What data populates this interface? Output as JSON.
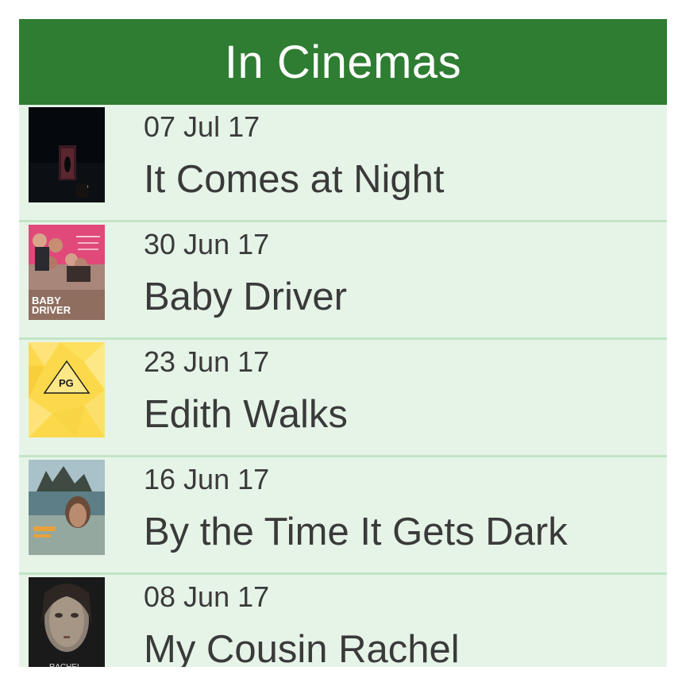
{
  "header": {
    "title": "In Cinemas"
  },
  "colors": {
    "header_bg": "#2e7d32",
    "list_bg": "#e6f4e8",
    "divider": "#c3e4c6",
    "text": "#3a3a3a"
  },
  "movies": [
    {
      "date": "07 Jul 17",
      "title": "It Comes at Night",
      "poster": "dark-door-poster-image"
    },
    {
      "date": "30 Jun 17",
      "title": "Baby Driver",
      "poster": "baby-driver-poster-image",
      "poster_text": "BABY DRIVER"
    },
    {
      "date": "23 Jun 17",
      "title": "Edith Walks",
      "poster": "pg-rating-placeholder-image",
      "poster_text": "PG"
    },
    {
      "date": "16 Jun 17",
      "title": "By the Time It Gets Dark",
      "poster": "landscape-portrait-poster-image"
    },
    {
      "date": "08 Jun 17",
      "title": "My Cousin Rachel",
      "poster": "text-face-poster-image",
      "poster_text": "RACHEL"
    }
  ]
}
